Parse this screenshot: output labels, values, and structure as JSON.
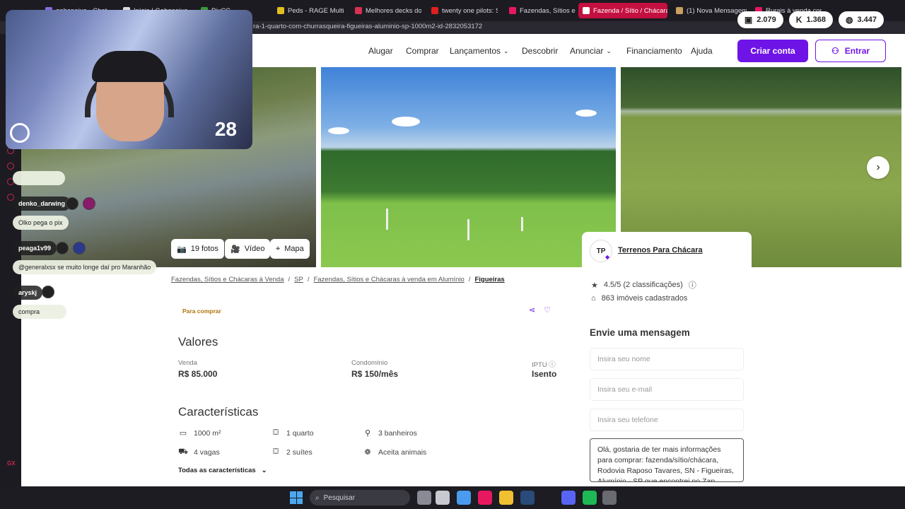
{
  "browser": {
    "tabs": [
      {
        "label": "gabepeixe - Chat",
        "color": "#8a6ad8"
      },
      {
        "label": "Início | Gabepeixe",
        "color": "#dcdcdc"
      },
      {
        "label": "PixCC",
        "color": "#3a9a3a"
      },
      {
        "label": "Peds - RAGE Multiplayer",
        "color": "#e0c020"
      },
      {
        "label": "Melhores decks do C",
        "color": "#d83050"
      },
      {
        "label": "twenty one pilots: St",
        "color": "#e02020"
      },
      {
        "label": "Fazendas, Sítios e C",
        "color": "#e81860"
      },
      {
        "label": "Fazenda / Sítio / Chácara",
        "color": "#ffffff"
      },
      {
        "label": "(1) Nova Mensagem!",
        "color": "#c8a060"
      },
      {
        "label": "Rurais à venda com",
        "color": "#e81860"
      }
    ],
    "url": "ra-1-quarto-com-churrasqueira-figueiras-aluminio-sp-1000m2-id-2832053172",
    "counters": [
      {
        "icon": "twitch-icon",
        "value": "2.079"
      },
      {
        "icon": "kick-icon",
        "value": "1.368"
      },
      {
        "icon": "globe-icon",
        "value": "3.447"
      }
    ]
  },
  "header": {
    "nav": [
      "Alugar",
      "Comprar",
      "Lançamentos",
      "Descobrir",
      "Anunciar",
      "Financiamento",
      "Ajuda"
    ],
    "create_account": "Criar conta",
    "login": "Entrar"
  },
  "gallery": {
    "photos_label": "19 fotos",
    "video_label": "Vídeo",
    "map_label": "Mapa"
  },
  "webcam": {
    "number": "28"
  },
  "chat": {
    "messages": [
      {
        "user": "",
        "text": ""
      },
      {
        "user": "denko_darwing",
        "text": "Olko pega o pix"
      },
      {
        "user": "peaga1v99",
        "text": "@generalxsx se muito longe daí pro Maranhão"
      },
      {
        "user": "aryskj",
        "text": "compra"
      }
    ]
  },
  "breadcrumb": [
    "Fazendas, Sítios e Chácaras à Venda",
    "SP",
    "Fazendas, Sítios e Chácaras à venda em Alumínio",
    "Figueiras"
  ],
  "listing": {
    "tag": "Para comprar",
    "values_title": "Valores",
    "venda_label": "Venda",
    "venda_value": "R$ 85.000",
    "condominio_label": "Condomínio",
    "condominio_value": "R$ 150/mês",
    "iptu_label": "IPTU",
    "iptu_value": "Isento",
    "features_title": "Características",
    "features": [
      {
        "icon": "area-icon",
        "glyph": "▭",
        "label": "1000 m²"
      },
      {
        "icon": "bed-icon",
        "glyph": "⛋",
        "label": "1 quarto"
      },
      {
        "icon": "shower-icon",
        "glyph": "⚲",
        "label": "3 banheiros"
      },
      {
        "icon": "car-icon",
        "glyph": "⛟",
        "label": "4 vagas"
      },
      {
        "icon": "bed-icon",
        "glyph": "⛋",
        "label": "2 suítes"
      },
      {
        "icon": "paw-icon",
        "glyph": "❁",
        "label": "Aceita animais"
      }
    ],
    "all_features": "Todas as características"
  },
  "agent": {
    "initials": "TP",
    "name": "Terrenos Para Chácara",
    "rating": "4.5/5 (2 classificações)",
    "listings": "863 imóveis cadastrados"
  },
  "contact": {
    "title": "Envie uma mensagem",
    "name_placeholder": "Insira seu nome",
    "email_placeholder": "Insira seu e-mail",
    "phone_placeholder": "Insira seu telefone",
    "message": "Olá, gostaria de ter mais informações para comprar: fazenda/sítio/chácara, Rodovia Raposo Tavares, SN - Figueiras, Alumínio - SP que encontrei no Zap"
  },
  "taskbar": {
    "search_placeholder": "Pesquisar",
    "apps": [
      {
        "name": "taskview-icon",
        "color": "#8a8a96"
      },
      {
        "name": "app-icon",
        "color": "#c8c8d0"
      },
      {
        "name": "copilot-icon",
        "color": "#4a9af0"
      },
      {
        "name": "opera-gx-icon",
        "color": "#e81860"
      },
      {
        "name": "explorer-icon",
        "color": "#f0c030"
      },
      {
        "name": "steam-icon",
        "color": "#2a4a7a"
      },
      {
        "name": "discord-icon",
        "color": "#5865f2"
      },
      {
        "name": "spotify-icon",
        "color": "#1db954"
      },
      {
        "name": "obs-icon",
        "color": "#6a6a72"
      }
    ]
  },
  "colors": {
    "brand": "#6e14e6",
    "tag": "#b0740c",
    "browser_accent": "#c41040"
  }
}
